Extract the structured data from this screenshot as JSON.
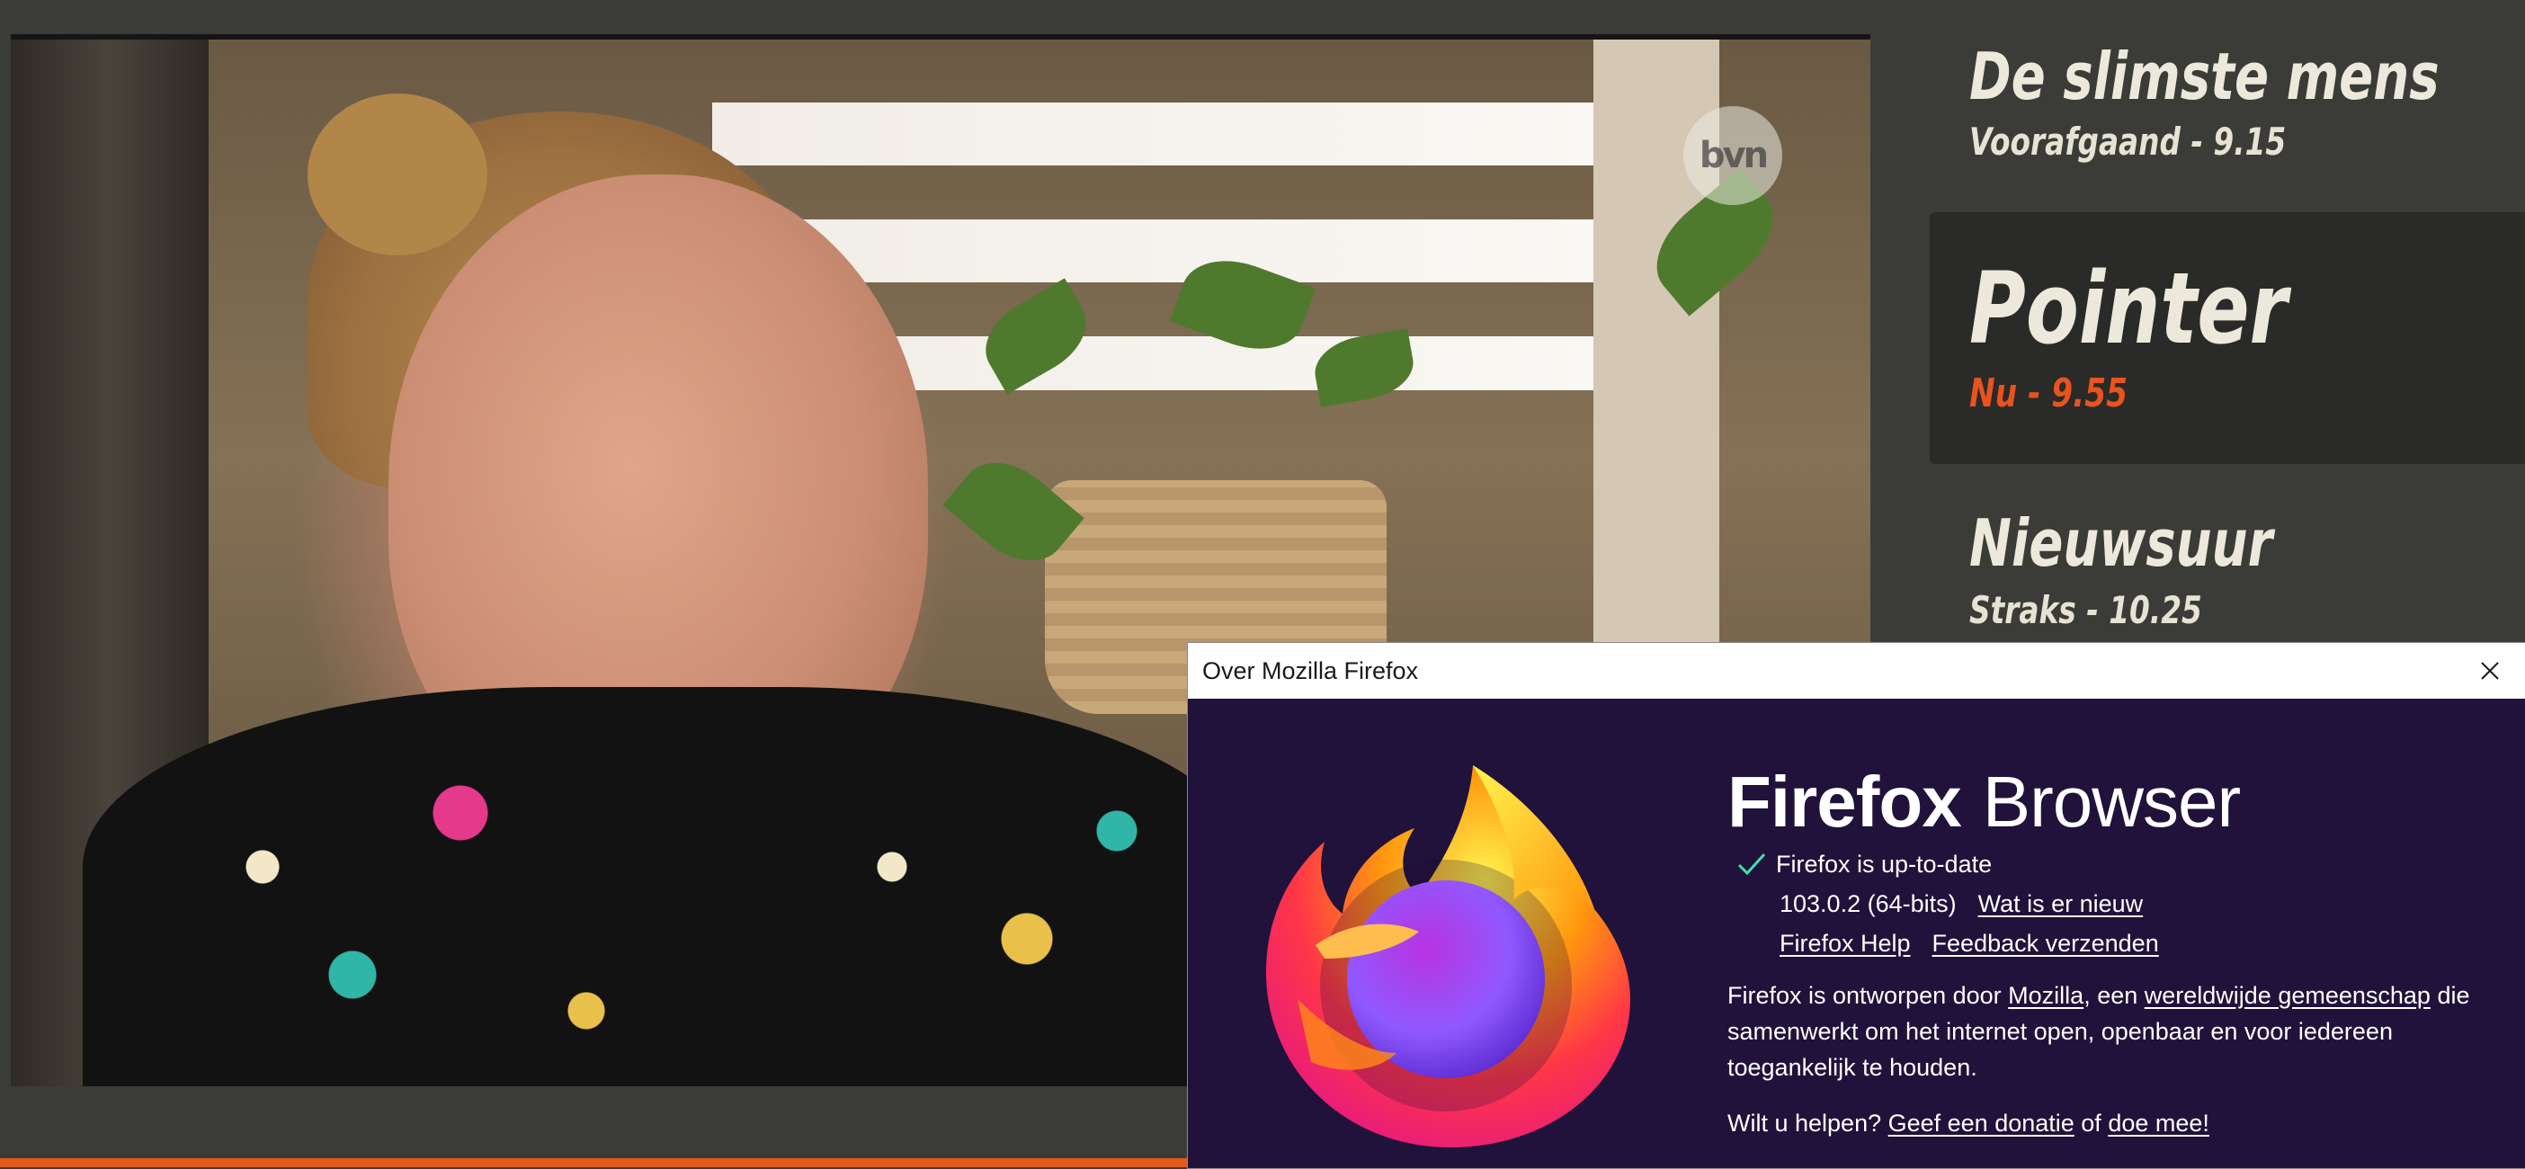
{
  "video": {
    "channel_logo": "bvn"
  },
  "schedule": [
    {
      "title": "De slimste mens",
      "subtitle": "Voorafgaand - 9.15"
    },
    {
      "title": "Pointer",
      "subtitle": "Nu - 9.55"
    },
    {
      "title": "Nieuwsuur",
      "subtitle": "Straks - 10.25"
    }
  ],
  "colors": {
    "current_accent": "#e8531f",
    "dialog_bg": "#20123a",
    "schedule_bg": "#3b3c38"
  },
  "dialog": {
    "title": "Over Mozilla Firefox",
    "close_icon": "close-icon",
    "brand_bold": "Firefox",
    "brand_light": "Browser",
    "status": "Firefox is up-to-date",
    "version": "103.0.2 (64-bits)",
    "whats_new": "Wat is er nieuw",
    "help_link": "Firefox Help",
    "feedback_link": "Feedback verzenden",
    "desc_part1": "Firefox is ontworpen door ",
    "mozilla_link": "Mozilla",
    "desc_part2": ", een ",
    "community_link": "wereldwijde gemeenschap",
    "desc_part3": " die samenwerkt om het internet open, openbaar en voor iedereen toegankelijk te houden.",
    "help_prefix": "Wilt u helpen? ",
    "donate_link": "Geef een donatie",
    "help_mid": " of ",
    "join_link": "doe mee!"
  }
}
